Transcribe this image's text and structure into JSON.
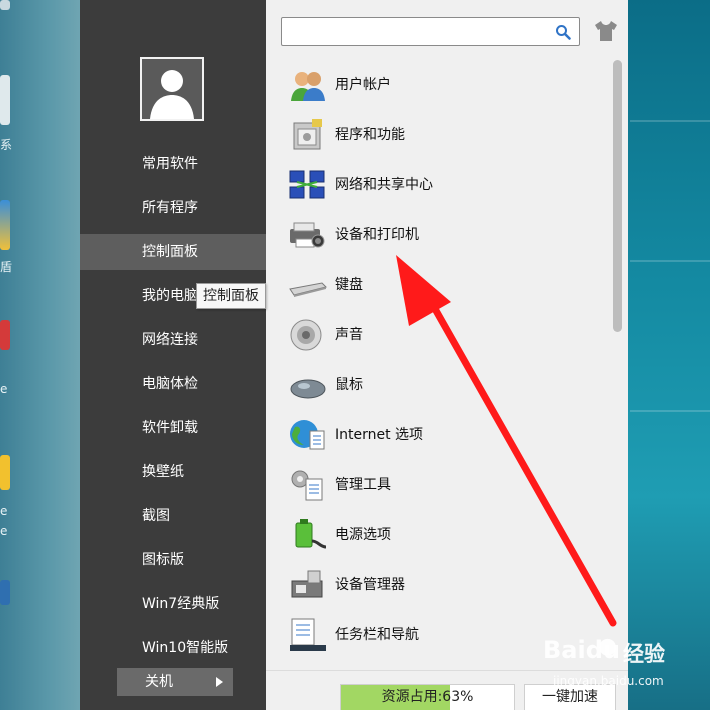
{
  "desktop": {
    "left_labels": [
      "系",
      "盾",
      "e",
      "e",
      "e"
    ]
  },
  "user": {
    "avatar_icon": "user-avatar-icon"
  },
  "nav": {
    "items": [
      {
        "label": "常用软件"
      },
      {
        "label": "所有程序"
      },
      {
        "label": "控制面板",
        "active": true
      },
      {
        "label": "我的电脑"
      },
      {
        "label": "网络连接"
      },
      {
        "label": "电脑体检"
      },
      {
        "label": "软件卸载"
      },
      {
        "label": "换壁纸"
      },
      {
        "label": "截图"
      },
      {
        "label": "图标版"
      },
      {
        "label": "Win7经典版"
      },
      {
        "label": "Win10智能版"
      }
    ],
    "tooltip": "控制面板",
    "shutdown_label": "关机"
  },
  "search": {
    "value": "",
    "placeholder": ""
  },
  "control_panel": {
    "items": [
      {
        "label": "用户帐户",
        "icon": "user-accounts-icon"
      },
      {
        "label": "程序和功能",
        "icon": "programs-features-icon"
      },
      {
        "label": "网络和共享中心",
        "icon": "network-sharing-icon"
      },
      {
        "label": "设备和打印机",
        "icon": "devices-printers-icon"
      },
      {
        "label": "键盘",
        "icon": "keyboard-icon"
      },
      {
        "label": "声音",
        "icon": "sound-icon"
      },
      {
        "label": "鼠标",
        "icon": "mouse-icon"
      },
      {
        "label": "Internet 选项",
        "icon": "internet-options-icon"
      },
      {
        "label": "管理工具",
        "icon": "admin-tools-icon"
      },
      {
        "label": "电源选项",
        "icon": "power-options-icon"
      },
      {
        "label": "设备管理器",
        "icon": "device-manager-icon"
      },
      {
        "label": "任务栏和导航",
        "icon": "taskbar-nav-icon"
      }
    ]
  },
  "status": {
    "usage_label": "资源占用:63%",
    "usage_percent": 63,
    "speedup_label": "一键加速"
  },
  "colors": {
    "menu_left_bg": "#3c3c3c",
    "menu_active_bg": "#5e5e5e",
    "usage_fill": "#a2d763",
    "annotation_arrow": "#ff1a1a"
  },
  "watermark": {
    "brand": "Baidu",
    "suffix": "经验",
    "url": "jingyan.baidu.com"
  }
}
